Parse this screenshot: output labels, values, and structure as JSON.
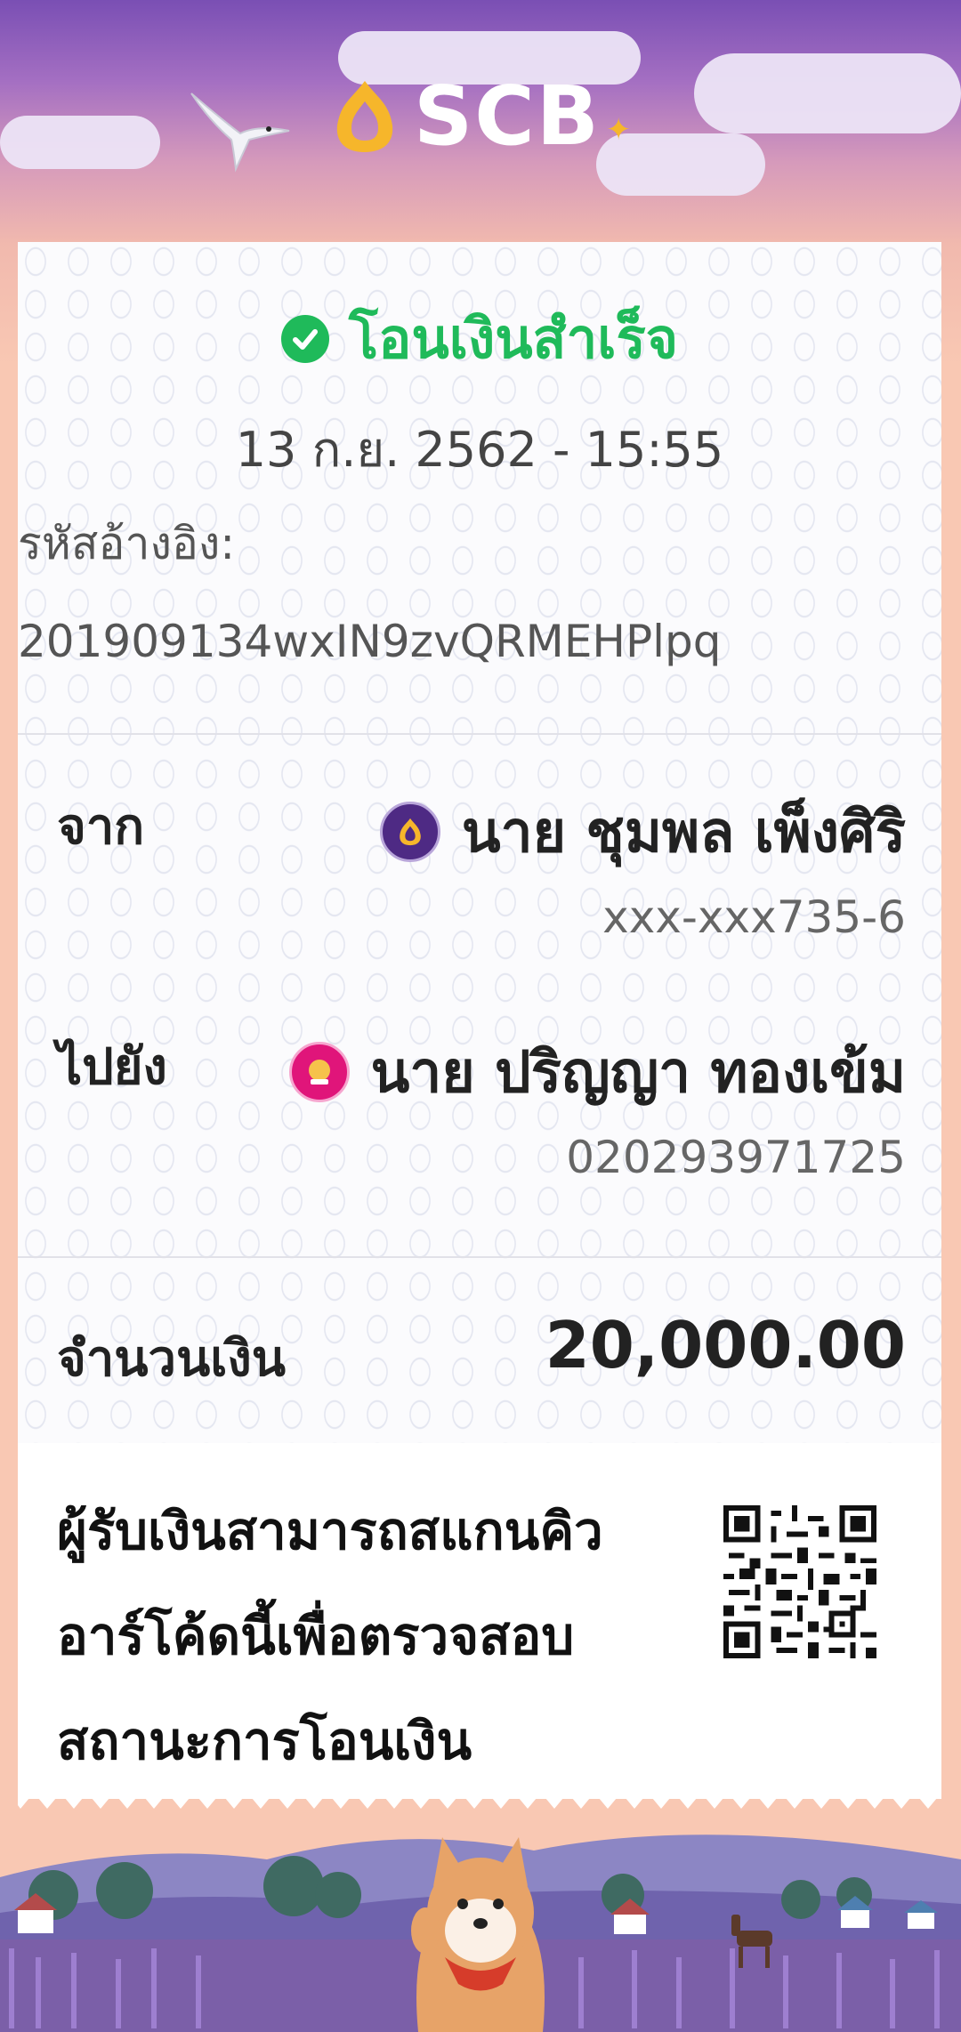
{
  "brand": {
    "name": "SCB"
  },
  "status": {
    "text": "โอนเงินสำเร็จ"
  },
  "datetime": "13 ก.ย. 2562 - 15:55",
  "reference": {
    "label": "รหัสอ้างอิง:",
    "value": "201909134wxIN9zvQRMEHPlpq"
  },
  "from": {
    "label": "จาก",
    "name": "นาย ชุมพล เพ็งศิริ",
    "account": "xxx-xxx735-6",
    "bank_color": "#4e2a84"
  },
  "to": {
    "label": "ไปยัง",
    "name": "นาย ปริญญา ทองเข้ม",
    "account": "020293971725",
    "bank_color": "#e0157a"
  },
  "amount": {
    "label": "จำนวนเงิน",
    "value": "20,000.00"
  },
  "qr": {
    "text_line1": "ผู้รับเงินสามารถสแกนคิว",
    "text_line2": "อาร์โค้ดนี้เพื่อตรวจสอบ",
    "text_line3": "สถานะการโอนเงิน"
  },
  "colors": {
    "success": "#1fba5a",
    "header_purple": "#7a4fb4",
    "background_peach": "#f9c8b3"
  }
}
